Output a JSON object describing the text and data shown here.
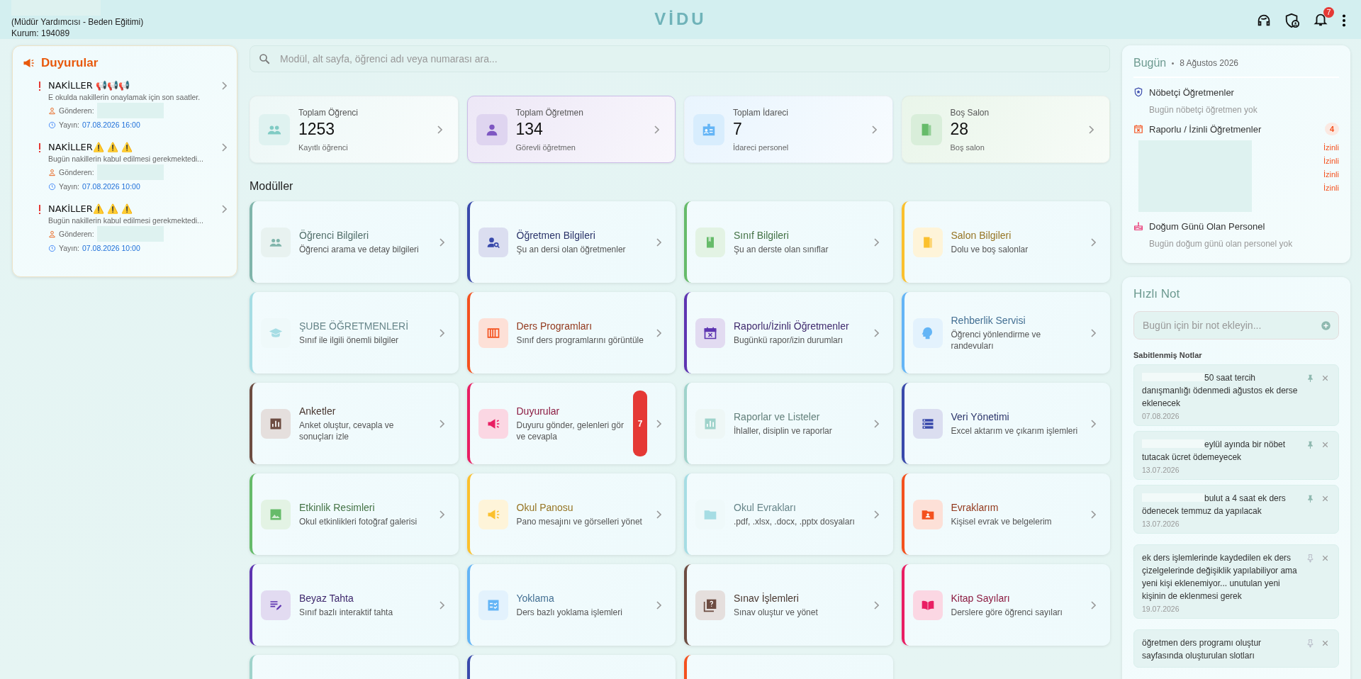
{
  "header": {
    "role": "(Müdür Yardımcısı - Beden Eğitimi)",
    "institution": "Kurum: 194089",
    "logo": "VİDU",
    "notification_count": "7"
  },
  "announcements": {
    "title": "Duyurular",
    "items": [
      {
        "title": "NAKİLLER 📢📢📢",
        "summary": "E okulda nakillerin onaylamak için son saatler.",
        "sender_label": "Gönderen:",
        "published_label": "Yayın:",
        "published": "07.08.2026 16:00"
      },
      {
        "title": "NAKİLLER⚠️ ⚠️ ⚠️",
        "summary": "Bugün nakillerin kabul edilmesi gerekmektedi...",
        "sender_label": "Gönderen:",
        "published_label": "Yayın:",
        "published": "07.08.2026 10:00"
      },
      {
        "title": "NAKİLLER⚠️ ⚠️ ⚠️",
        "summary": "Bugün nakillerin kabul edilmesi gerekmektedi...",
        "sender_label": "Gönderen:",
        "published_label": "Yayın:",
        "published": "07.08.2026 10:00"
      }
    ]
  },
  "search": {
    "placeholder": "Modül, alt sayfa, öğrenci adı veya numarası ara..."
  },
  "stats": [
    {
      "label": "Toplam Öğrenci",
      "value": "1253",
      "caption": "Kayıtlı öğrenci",
      "color": "#80cbc4",
      "selected": false
    },
    {
      "label": "Toplam Öğretmen",
      "value": "134",
      "caption": "Görevli öğretmen",
      "color": "#7e57c2",
      "selected": true
    },
    {
      "label": "Toplam İdareci",
      "value": "7",
      "caption": "İdareci personel",
      "color": "#64b5f6",
      "selected": false
    },
    {
      "label": "Boş Salon",
      "value": "28",
      "caption": "Boş salon",
      "color": "#66bb6a",
      "selected": false
    }
  ],
  "modules_title": "Modüller",
  "modules": [
    {
      "title": "Öğrenci Bilgileri",
      "subtitle": "Öğrenci arama ve detay bilgileri",
      "color": "#80b5ab"
    },
    {
      "title": "Öğretmen Bilgileri",
      "subtitle": "Şu an dersi olan öğretmenler",
      "color": "#3949ab"
    },
    {
      "title": "Sınıf Bilgileri",
      "subtitle": "Şu an derste olan sınıflar",
      "color": "#66bb6a"
    },
    {
      "title": "Salon Bilgileri",
      "subtitle": "Dolu ve boş salonlar",
      "color": "#fbc02d"
    },
    {
      "title": "ŞUBE ÖĞRETMENLERİ",
      "subtitle": "Sınıf ile ilgili önemli bilgiler",
      "color": "#a6dde4"
    },
    {
      "title": "Ders Programları",
      "subtitle": "Sınıf ders programlarını görüntüle",
      "color": "#f4511e"
    },
    {
      "title": "Raporlu/İzinli Öğretmenler",
      "subtitle": "Bugünkü rapor/izin durumları",
      "color": "#5e35b1"
    },
    {
      "title": "Rehberlik Servisi",
      "subtitle": "Öğrenci yönlendirme ve randevuları",
      "color": "#64b5f6"
    },
    {
      "title": "Anketler",
      "subtitle": "Anket oluştur, cevapla ve sonuçları izle",
      "color": "#6d4c41"
    },
    {
      "title": "Duyurular",
      "subtitle": "Duyuru gönder, gelenleri gör ve cevapla",
      "color": "#e91e63",
      "badge": "7"
    },
    {
      "title": "Raporlar ve Listeler",
      "subtitle": "İhlaller, disiplin ve raporlar",
      "color": "#9fd3cb"
    },
    {
      "title": "Veri Yönetimi",
      "subtitle": "Excel aktarım ve çıkarım işlemleri",
      "color": "#3949ab"
    },
    {
      "title": "Etkinlik Resimleri",
      "subtitle": "Okul etkinlikleri fotoğraf galerisi",
      "color": "#66bb6a"
    },
    {
      "title": "Okul Panosu",
      "subtitle": "Pano mesajını ve görselleri yönet",
      "color": "#fbc02d"
    },
    {
      "title": "Okul Evrakları",
      "subtitle": ".pdf, .xlsx, .docx, .pptx dosyaları",
      "color": "#a6dde4"
    },
    {
      "title": "Evraklarım",
      "subtitle": "Kişisel evrak ve belgelerim",
      "color": "#f4511e"
    },
    {
      "title": "Beyaz Tahta",
      "subtitle": "Sınıf bazlı interaktif tahta",
      "color": "#5e35b1"
    },
    {
      "title": "Yoklama",
      "subtitle": "Ders bazlı yoklama işlemleri",
      "color": "#64b5f6"
    },
    {
      "title": "Sınav İşlemleri",
      "subtitle": "Sınav oluştur ve yönet",
      "color": "#6d4c41"
    },
    {
      "title": "Kitap Sayıları",
      "subtitle": "Derslere göre öğrenci sayıları",
      "color": "#e91e63"
    }
  ],
  "more_modules": [
    {
      "color": "#9fd3cb"
    },
    {
      "color": "#3949ab"
    },
    {
      "color": "#f4511e"
    }
  ],
  "today": {
    "title": "Bugün",
    "date": "8 Ağustos 2026",
    "sections": [
      {
        "kind": "duty",
        "title": "Nöbetçi Öğretmenler",
        "empty_text": "Bugün nöbetçi öğretmen yok"
      },
      {
        "kind": "leave",
        "title": "Raporlu / İzinli Öğretmenler",
        "count": "4",
        "statuses": [
          "İzinli",
          "İzinli",
          "İzinli",
          "İzinli"
        ]
      },
      {
        "kind": "birthday",
        "title": "Doğum Günü Olan Personel",
        "empty_text": "Bugün doğum günü olan personel yok"
      }
    ]
  },
  "quick_note": {
    "title": "Hızlı Not",
    "placeholder": "Bugün için bir not ekleyin...",
    "pinned_title": "Sabitlenmiş Notlar",
    "notes": [
      {
        "text": "50 saat tercih danışmanlığı ödenmedi ağustos ek derse eklenecek",
        "date": "07.08.2026",
        "pinned": true,
        "redacted": true
      },
      {
        "text": "eylül ayında bir nöbet tutacak ücret ödemeyecek",
        "date": "13.07.2026",
        "pinned": true,
        "redacted": true
      },
      {
        "text": "bulut a 4 saat ek ders ödenecek temmuz da yapılacak",
        "date": "13.07.2026",
        "pinned": true,
        "redacted": true
      },
      {
        "text": "ek ders işlemlerinde kaydedilen ek ders çizelgelerinde değişiklik yapılabiliyor ama yeni kişi eklenemiyor... unutulan yeni kişinin de eklenmesi gerek",
        "date": "19.07.2026",
        "pinned": false,
        "redacted": false
      },
      {
        "text": "öğretmen ders programı oluştur sayfasında oluşturulan slotları",
        "pinned": false,
        "redacted": false
      }
    ]
  }
}
